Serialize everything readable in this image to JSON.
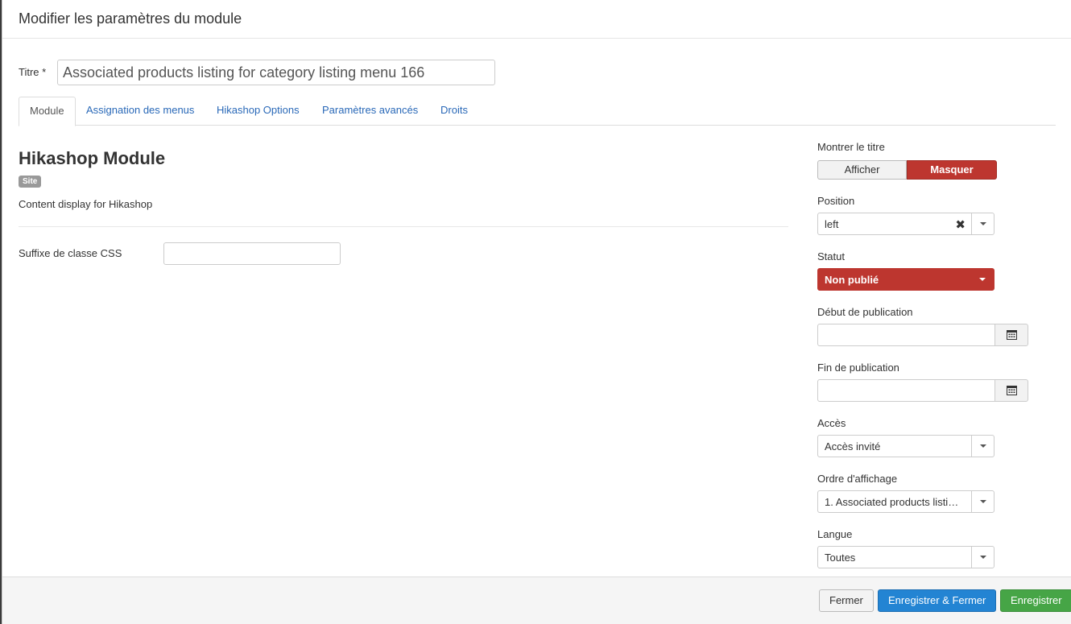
{
  "modal": {
    "title": "Modifier les paramètres du module"
  },
  "title_field": {
    "label": "Titre *",
    "value": "Associated products listing for category listing menu 166"
  },
  "tabs": [
    {
      "label": "Module",
      "active": true
    },
    {
      "label": "Assignation des menus",
      "active": false
    },
    {
      "label": "Hikashop Options",
      "active": false
    },
    {
      "label": "Paramètres avancés",
      "active": false
    },
    {
      "label": "Droits",
      "active": false
    }
  ],
  "main": {
    "module_title": "Hikashop Module",
    "badge": "Site",
    "description": "Content display for Hikashop",
    "css_suffix_label": "Suffixe de classe CSS",
    "css_suffix_value": ""
  },
  "sidebar": {
    "show_title": {
      "label": "Montrer le titre",
      "off_label": "Afficher",
      "on_label": "Masquer",
      "selected": "Masquer"
    },
    "position": {
      "label": "Position",
      "value": "left"
    },
    "status": {
      "label": "Statut",
      "value": "Non publié"
    },
    "publish_up": {
      "label": "Début de publication",
      "value": ""
    },
    "publish_down": {
      "label": "Fin de publication",
      "value": ""
    },
    "access": {
      "label": "Accès",
      "value": "Accès invité"
    },
    "ordering": {
      "label": "Ordre d'affichage",
      "value": "1. Associated products listing for category listing menu 166"
    },
    "language": {
      "label": "Langue",
      "value": "Toutes"
    }
  },
  "footer": {
    "close_label": "Fermer",
    "save_close_label": "Enregistrer & Fermer",
    "save_label": "Enregistrer"
  },
  "colors": {
    "danger": "#bd362f",
    "primary": "#2384d3",
    "success": "#46a546",
    "link": "#2a69b8"
  },
  "icons": {
    "clear": "close-icon",
    "dropdown": "caret-down-icon",
    "calendar": "calendar-icon"
  }
}
